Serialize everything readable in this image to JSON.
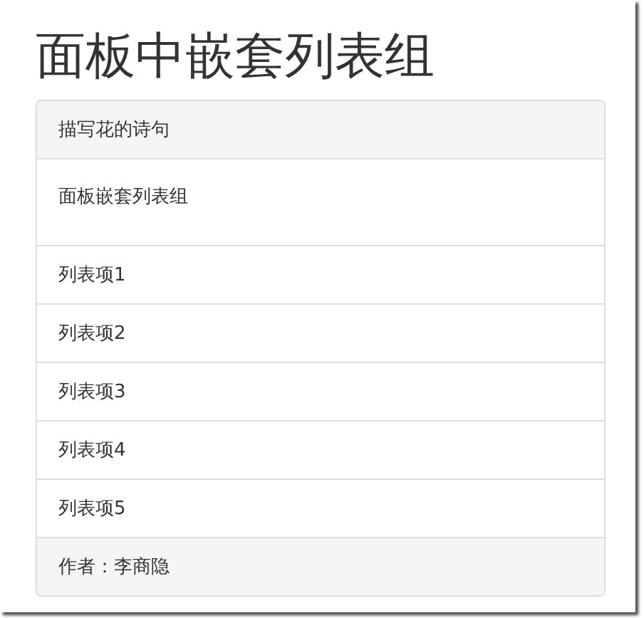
{
  "page_title": "面板中嵌套列表组",
  "panel": {
    "heading": "描写花的诗句",
    "body": "面板嵌套列表组",
    "items": [
      "列表项1",
      "列表项2",
      "列表项3",
      "列表项4",
      "列表项5"
    ],
    "footer": "作者：李商隐"
  }
}
